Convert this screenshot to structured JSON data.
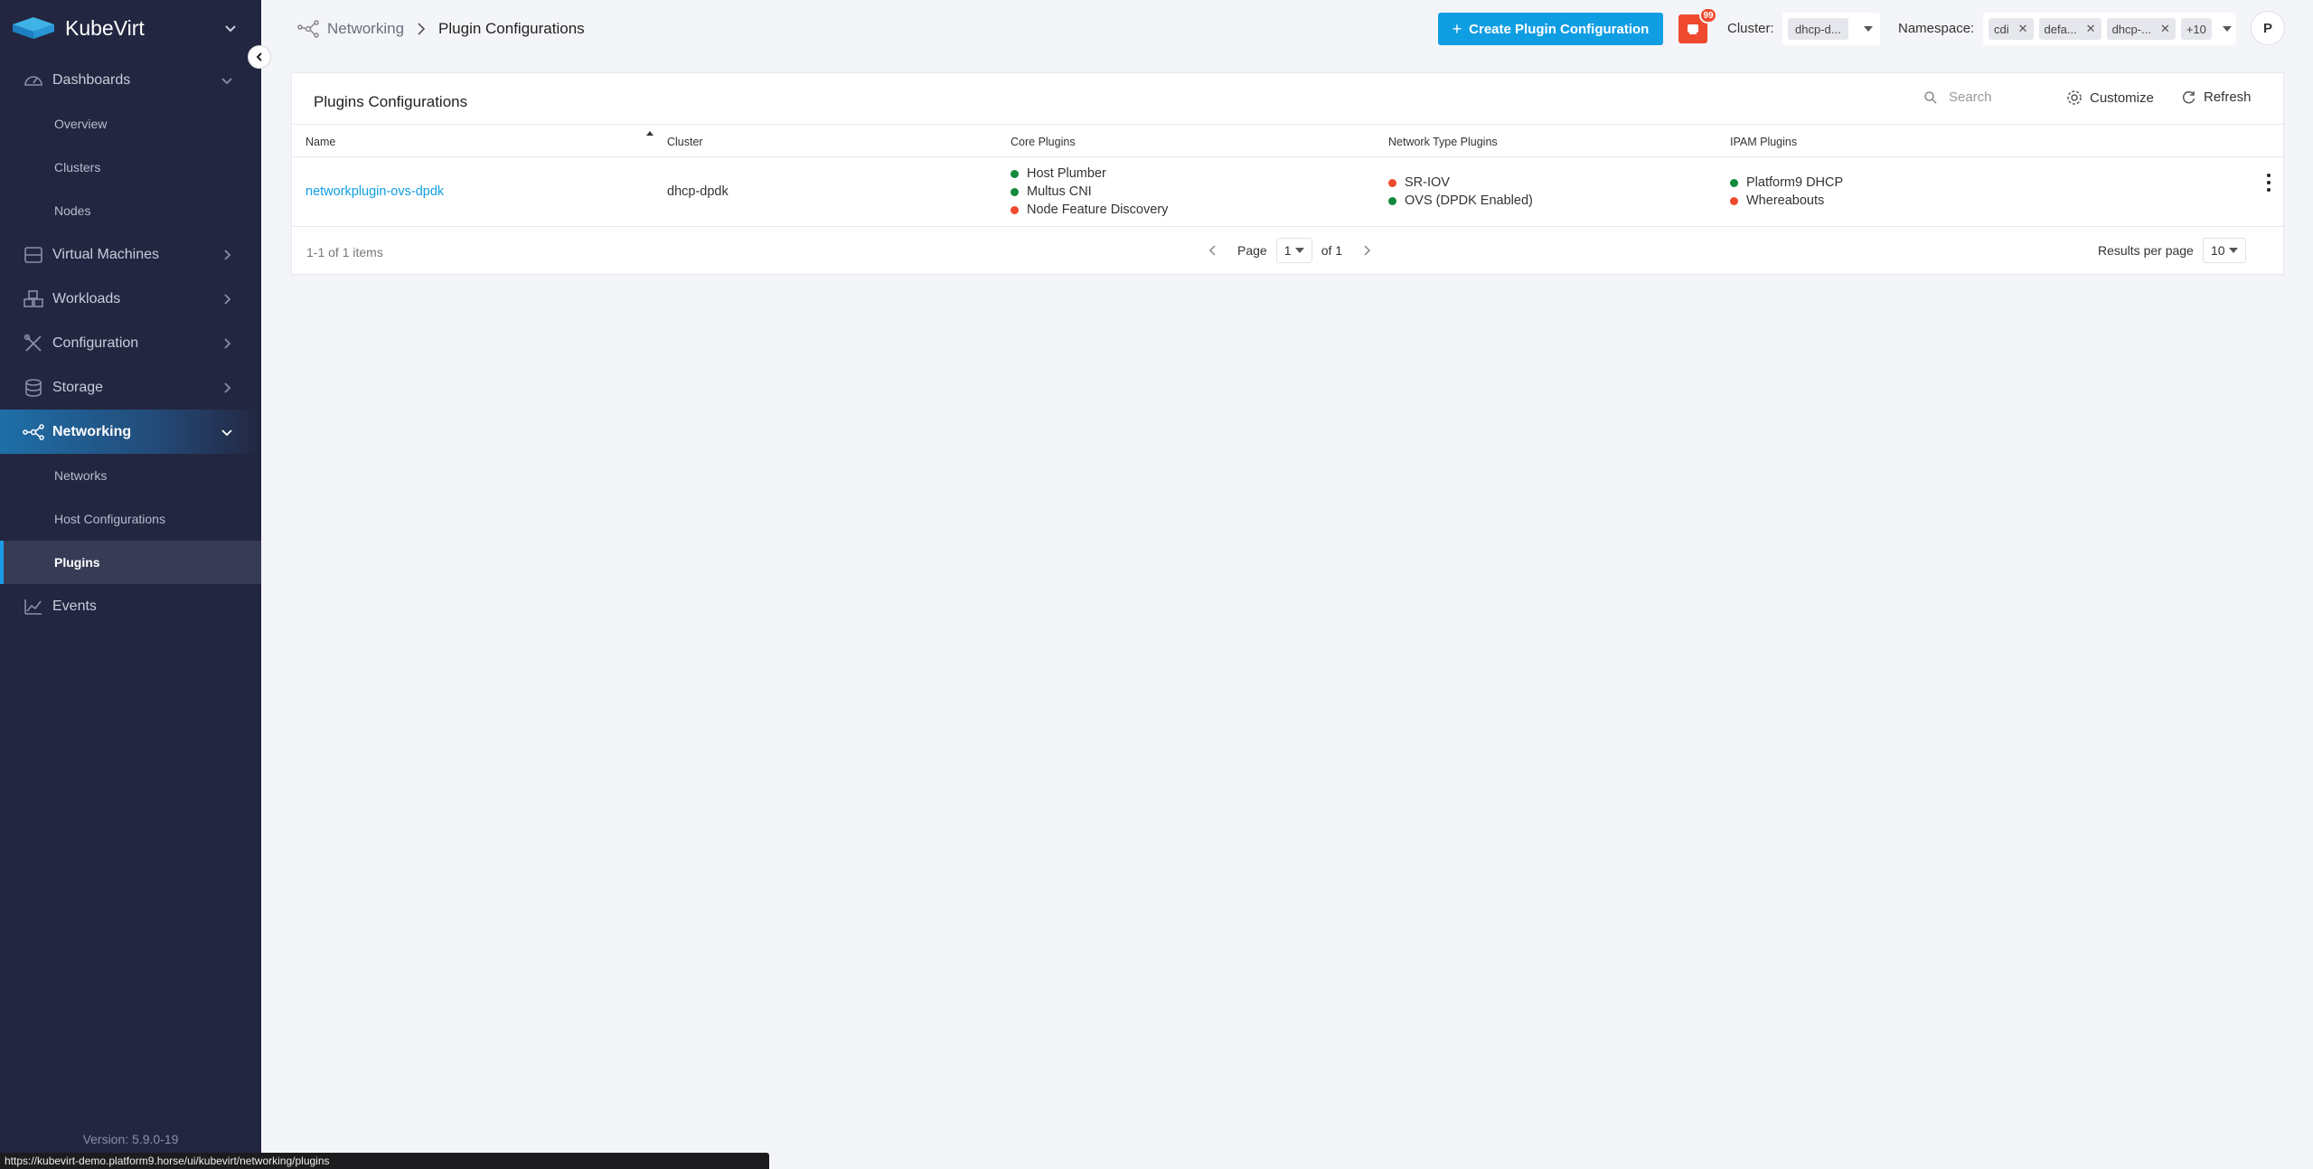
{
  "app": {
    "brand": "KubeVirt",
    "version": "Version: 5.9.0-19"
  },
  "sidebar": {
    "sections": [
      {
        "label": "Dashboards",
        "icon": "gauge-icon",
        "expanded": true,
        "items": [
          "Overview",
          "Clusters",
          "Nodes"
        ]
      },
      {
        "label": "Virtual Machines",
        "icon": "server-icon"
      },
      {
        "label": "Workloads",
        "icon": "cubes-icon"
      },
      {
        "label": "Configuration",
        "icon": "tools-icon"
      },
      {
        "label": "Storage",
        "icon": "database-icon"
      },
      {
        "label": "Networking",
        "icon": "network-icon",
        "expanded": true,
        "active": true,
        "items": [
          "Networks",
          "Host Configurations",
          "Plugins"
        ],
        "active_item": "Plugins"
      },
      {
        "label": "Events",
        "icon": "chart-icon"
      }
    ]
  },
  "header": {
    "breadcrumb_root": "Networking",
    "breadcrumb_current": "Plugin Configurations",
    "create_button": "Create Plugin Configuration",
    "alert_count": "99",
    "cluster_label": "Cluster:",
    "cluster_value": "dhcp-d...",
    "namespace_label": "Namespace:",
    "namespace_chips": [
      "cdi",
      "defa...",
      "dhcp-..."
    ],
    "namespace_more": "+10",
    "avatar_initial": "P"
  },
  "card": {
    "title": "Plugins Configurations",
    "search_placeholder": "Search",
    "customize_label": "Customize",
    "refresh_label": "Refresh",
    "columns": [
      "Name",
      "Cluster",
      "Core Plugins",
      "Network Type Plugins",
      "IPAM Plugins"
    ],
    "rows": [
      {
        "name": "networkplugin-ovs-dpdk",
        "cluster": "dhcp-dpdk",
        "core_plugins": [
          {
            "label": "Host Plumber",
            "status": "ok"
          },
          {
            "label": "Multus CNI",
            "status": "ok"
          },
          {
            "label": "Node Feature Discovery",
            "status": "off"
          }
        ],
        "network_plugins": [
          {
            "label": "SR-IOV",
            "status": "off"
          },
          {
            "label": "OVS (DPDK Enabled)",
            "status": "ok"
          }
        ],
        "ipam_plugins": [
          {
            "label": "Platform9 DHCP",
            "status": "ok"
          },
          {
            "label": "Whereabouts",
            "status": "off"
          }
        ]
      }
    ],
    "footer_count": "1-1 of 1 items",
    "page_label": "Page",
    "page_value": "1",
    "page_of": "of 1",
    "results_per_page_label": "Results per page",
    "results_per_page_value": "10"
  },
  "status_url": "https://kubevirt-demo.platform9.horse/ui/kubevirt/networking/plugins",
  "colors": {
    "accent": "#109ee3",
    "sidebar_bg": "#232640",
    "ok": "#138a3c",
    "off": "#ef4a2e",
    "alert": "#ef4a2e"
  }
}
